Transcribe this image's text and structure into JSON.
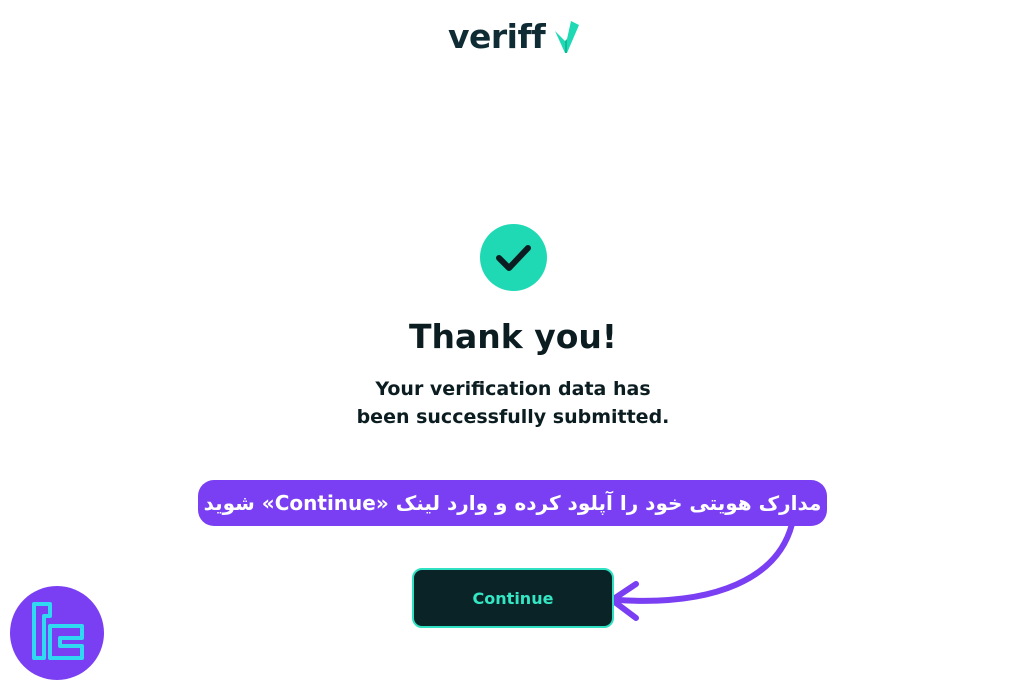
{
  "header": {
    "logo_text": "veriff",
    "logo_icon": "veriff-v-mark-icon",
    "brand_color": "#0f2c35",
    "accent_color": "#1fd9b5"
  },
  "main": {
    "status_icon": "check-circle-icon",
    "title": "Thank you!",
    "message_line1": "Your verification data has",
    "message_line2": "been successfully submitted.",
    "continue_label": "Continue"
  },
  "annotation": {
    "text": "مدارک هویتی خود را آپلود کرده و وارد لینک «Continue» شوید",
    "color": "#7a3ff2",
    "arrow_icon": "curved-arrow-icon"
  },
  "watermark": {
    "icon": "tradingfinder-logo-icon",
    "color": "#7a3ff2"
  }
}
